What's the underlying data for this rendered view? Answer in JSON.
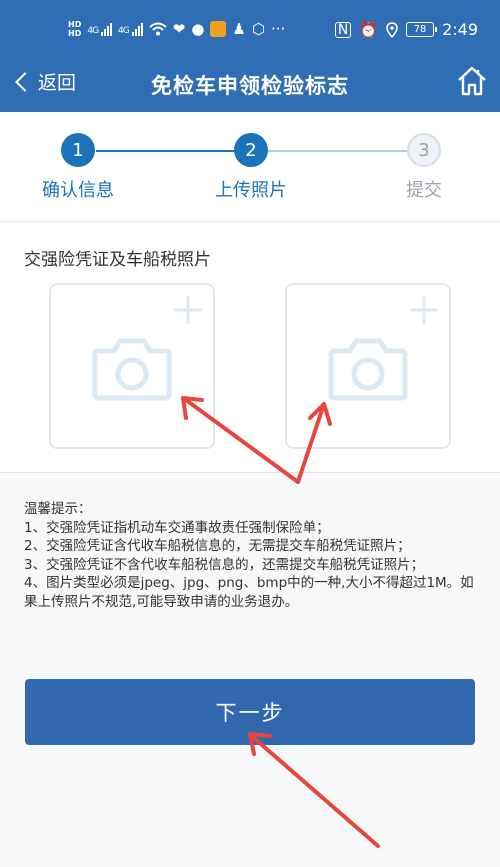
{
  "status_bar": {
    "hd1": "HD",
    "hd2": "HD",
    "net1": "4G",
    "net2": "4G",
    "battery": "78",
    "time": "2:49",
    "icons": [
      "wifi-icon",
      "health-icon",
      "message-icon",
      "app-icon",
      "qq-icon",
      "shield-icon",
      "more-icon",
      "nfc-icon",
      "alarm-icon",
      "location-icon"
    ]
  },
  "nav": {
    "back_label": "返回",
    "title": "免检车申领检验标志",
    "home_icon": "home-icon"
  },
  "stepper": {
    "steps": [
      {
        "number": "1",
        "label": "确认信息",
        "state": "done"
      },
      {
        "number": "2",
        "label": "上传照片",
        "state": "current"
      },
      {
        "number": "3",
        "label": "提交",
        "state": "pending"
      }
    ]
  },
  "upload": {
    "title": "交强险凭证及车船税照片",
    "boxes": [
      "camera-icon",
      "camera-icon"
    ]
  },
  "tips": {
    "heading": "温馨提示：",
    "items": [
      "1、交强险凭证指机动车交通事故责任强制保险单；",
      "2、交强险凭证含代收车船税信息的，无需提交车船税凭证照片；",
      "3、交强险凭证不含代收车船税信息的，还需提交车船税凭证照片；",
      "4、图片类型必须是jpeg、jpg、png、bmp中的一种,大小不得超过1M。如果上传照片不规范,可能导致申请的业务退办。"
    ]
  },
  "next_button": {
    "label": "下一步"
  },
  "colors": {
    "header": "#2f6db5",
    "step_active": "#1b74ba",
    "button": "#3168b0",
    "annotation": "#e8453c"
  }
}
